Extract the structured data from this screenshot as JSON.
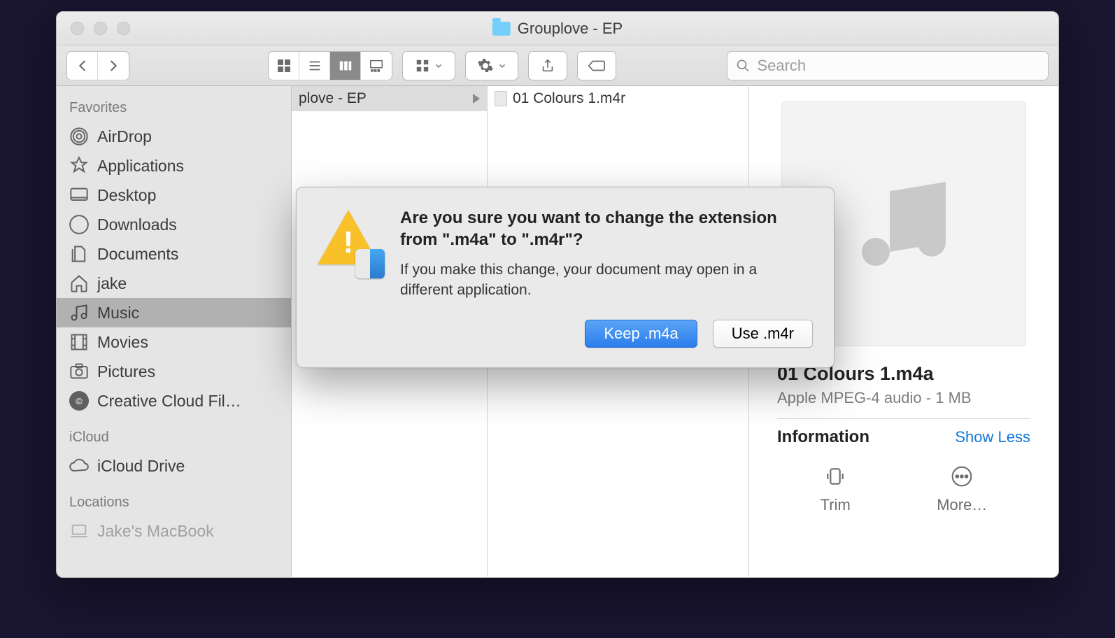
{
  "window": {
    "title": "Grouplove - EP"
  },
  "toolbar": {
    "search_placeholder": "Search"
  },
  "sidebar": {
    "sections": [
      {
        "header": "Favorites",
        "items": [
          {
            "label": "AirDrop",
            "icon": "airdrop"
          },
          {
            "label": "Applications",
            "icon": "apps"
          },
          {
            "label": "Desktop",
            "icon": "desktop"
          },
          {
            "label": "Downloads",
            "icon": "downloads"
          },
          {
            "label": "Documents",
            "icon": "documents"
          },
          {
            "label": "jake",
            "icon": "home"
          },
          {
            "label": "Music",
            "icon": "music",
            "selected": true
          },
          {
            "label": "Movies",
            "icon": "movies"
          },
          {
            "label": "Pictures",
            "icon": "pictures"
          },
          {
            "label": "Creative Cloud Fil…",
            "icon": "cc"
          }
        ]
      },
      {
        "header": "iCloud",
        "items": [
          {
            "label": "iCloud Drive",
            "icon": "cloud"
          }
        ]
      },
      {
        "header": "Locations",
        "items": [
          {
            "label": "Jake's MacBook",
            "icon": "laptop"
          }
        ]
      }
    ]
  },
  "columns": {
    "col1_item": "plove - EP",
    "col2_item": "01 Colours 1.m4r"
  },
  "preview": {
    "name": "01 Colours 1.m4a",
    "subtitle": "Apple MPEG-4 audio - 1 MB",
    "info_header": "Information",
    "show_less": "Show Less",
    "actions": {
      "trim": "Trim",
      "more": "More…"
    }
  },
  "dialog": {
    "title": "Are you sure you want to change the extension from \".m4a\" to \".m4r\"?",
    "message": "If you make this change, your document may open in a different application.",
    "primary": "Keep .m4a",
    "secondary": "Use .m4r"
  }
}
